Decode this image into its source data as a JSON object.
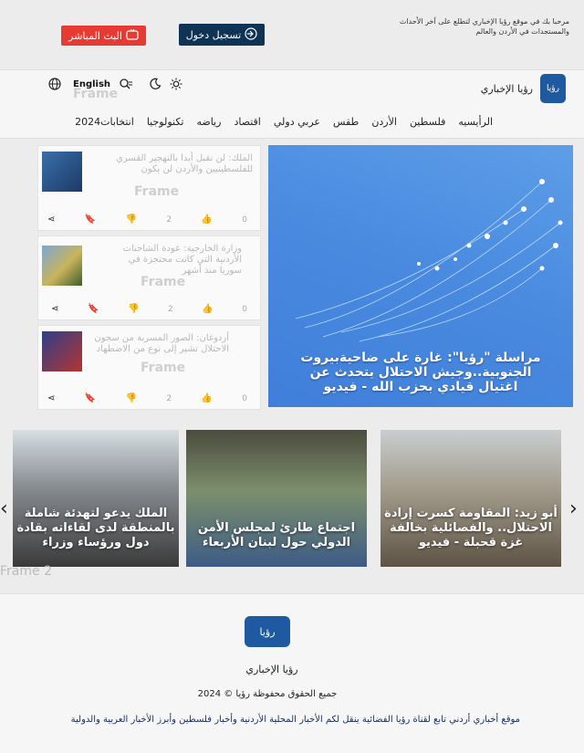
{
  "topbar": {
    "welcome": "مرحبا بك في موقع رؤيا الإخباري لتطلع على آخر الأحداث والمستجدات في الأردن والعالم",
    "login_label": "تسجيل دخول",
    "live_label": "البث المباشر",
    "login_color": "#0f3355",
    "live_color": "#e63a33"
  },
  "header": {
    "site_name": "رؤيا الإخباري",
    "logo_text": "رؤيا",
    "language": "English",
    "frame_ghost": "Frame"
  },
  "nav": {
    "items": [
      "الرأيسيه",
      "فلسطين",
      "الأردن",
      "طقس",
      "عربي دولي",
      "اقتصاد",
      "رياضه",
      "تكنولوجيا",
      "انتخابات2024"
    ]
  },
  "hero": {
    "title": "مراسلة \"رؤيا\": غارة على ضاحيةبيروت الجنوبية..وجيش الاحتلال يتحدث عن اغتيال قيادي بحزب الله - فيديو"
  },
  "side_news": [
    {
      "title": "الملك: لن نقبل أبدا بالتهجير القسري للفلسطينيين والأردن لن يكون",
      "ghost": "Frame",
      "likes": "0",
      "dislikes": "2"
    },
    {
      "title": "وزارة الخارجية: عودة الشاحنات الأردنية التي كانت محتجزة في سوريا منذ أشهر",
      "ghost": "Frame",
      "likes": "0",
      "dislikes": "2"
    },
    {
      "title": "أردوغان: الصور المسربة من سجون الاحتلال تشير إلى نوع من الاضطهاد",
      "ghost": "Frame",
      "likes": "0",
      "dislikes": "2"
    }
  ],
  "slider": {
    "slides": [
      {
        "title": "الملك يدعو لتهدئة شاملة بالمنطقة لدى لقاءاته بقادة دول ورؤساء وزراء"
      },
      {
        "title": "اجتماع طارئ لمجلس الأمن الدولي حول لبنان الأربعاء"
      },
      {
        "title": "أبو زيد: المقاومة كسرت إرادة الاحتلال.. والفصائلية بخالفة غزة قحبلة - فيديو"
      }
    ],
    "frame_label": "Frame 2",
    "dots": "..."
  },
  "footer": {
    "logo_text": "رؤيا",
    "site_name": "رؤيا الإخباري",
    "copyright": "جميع الحقوق محفوظة رؤيا © 2024",
    "description": "موقع أخباري أردني تابع لقناة رؤيا الفضائية ينقل لكم الأخبار المحلية الأردنية وأخبار فلسطين وأبرز الأخبار العربية والدولية"
  }
}
